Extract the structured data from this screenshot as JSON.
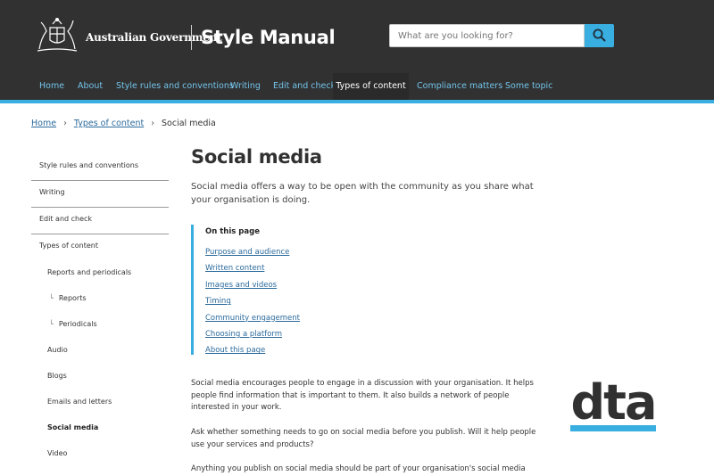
{
  "header": {
    "gov_name": "Australian Government",
    "site_title": "Style Manual",
    "search_placeholder": "What are you looking for?"
  },
  "nav": [
    {
      "label": "Home"
    },
    {
      "label": "About"
    },
    {
      "label": "Style rules and conventions"
    },
    {
      "label": "Writing"
    },
    {
      "label": "Edit and check"
    },
    {
      "label": "Types of content",
      "active": true
    },
    {
      "label": "Compliance matters"
    },
    {
      "label": "Some topic"
    }
  ],
  "breadcrumb": {
    "home": "Home",
    "section": "Types of content",
    "current": "Social media",
    "separator": "›"
  },
  "sidebar": [
    {
      "label": "Style rules and conventions"
    },
    {
      "label": "Writing"
    },
    {
      "label": "Edit and check"
    },
    {
      "label": "Types of content"
    },
    {
      "label": "Reports and periodicals"
    },
    {
      "label": "Reports"
    },
    {
      "label": "Periodicals"
    },
    {
      "label": "Audio"
    },
    {
      "label": "Blogs"
    },
    {
      "label": "Emails and letters"
    },
    {
      "label": "Social media",
      "active": true
    },
    {
      "label": "Video"
    }
  ],
  "indent_glyph": "└",
  "main": {
    "title": "Social media",
    "lead": "Social media offers a way to be open with the community as you share what your organisation is doing.",
    "toc_title": "On this page",
    "toc": [
      "Purpose and audience",
      "Written content",
      "Images and videos",
      "Timing",
      "Community engagement",
      "Choosing a platform",
      "About this page"
    ],
    "paragraphs": [
      "Social media encourages people to engage in a discussion with your organisation. It helps people find information that is important to them. It also builds a network of people interested in your work.",
      "Ask whether something needs to go on social media before you publish. Will it help people use your services and products?",
      "Anything you publish on social media should be part of your organisation's social media"
    ]
  },
  "logo": {
    "text": "dta",
    "bar_color": "#39aee0",
    "text_color": "#313131"
  }
}
